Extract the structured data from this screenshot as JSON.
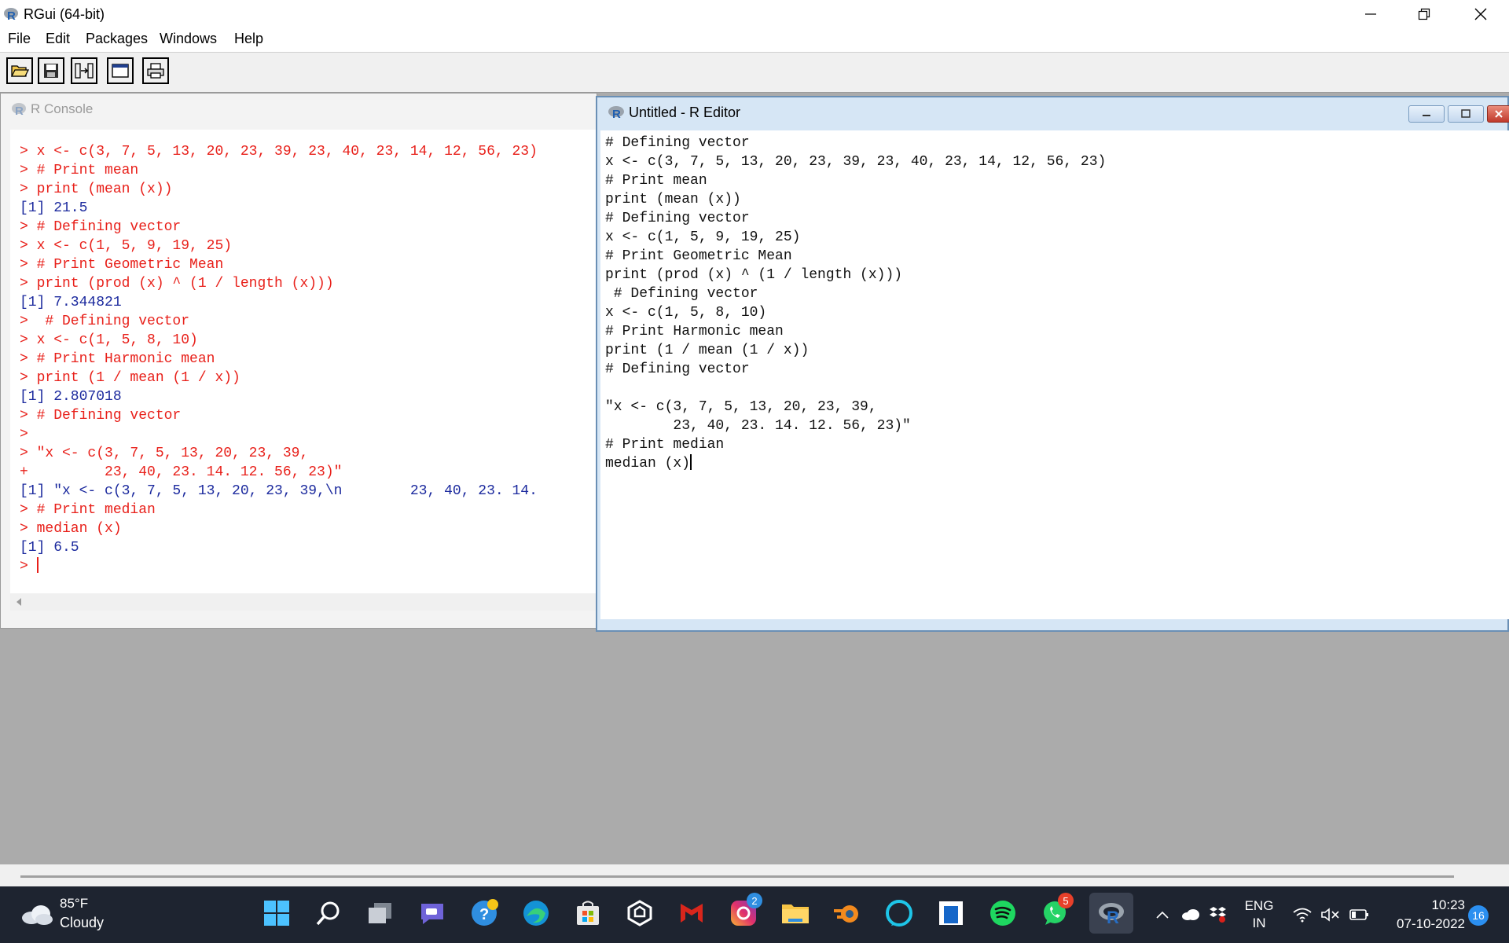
{
  "window": {
    "title": "RGui (64-bit)"
  },
  "menu": [
    "File",
    "Edit",
    "Packages",
    "Windows",
    "Help"
  ],
  "toolbar": {
    "buttons": [
      "open-script",
      "save",
      "load-workspace",
      "new-window",
      "print"
    ]
  },
  "console": {
    "title": "R Console",
    "lines": [
      {
        "t": "> x <- c(3, 7, 5, 13, 20, 23, 39, 23, 40, 23, 14, 12, 56, 23)",
        "k": "in"
      },
      {
        "t": "> # Print mean",
        "k": "in"
      },
      {
        "t": "> print (mean (x))",
        "k": "in"
      },
      {
        "t": "[1] 21.5",
        "k": "out"
      },
      {
        "t": "> # Defining vector",
        "k": "in"
      },
      {
        "t": "> x <- c(1, 5, 9, 19, 25)",
        "k": "in"
      },
      {
        "t": "> # Print Geometric Mean",
        "k": "in"
      },
      {
        "t": "> print (prod (x) ^ (1 / length (x)))",
        "k": "in"
      },
      {
        "t": "[1] 7.344821",
        "k": "out"
      },
      {
        "t": ">  # Defining vector",
        "k": "in"
      },
      {
        "t": "> x <- c(1, 5, 8, 10)",
        "k": "in"
      },
      {
        "t": "> # Print Harmonic mean",
        "k": "in"
      },
      {
        "t": "> print (1 / mean (1 / x))",
        "k": "in"
      },
      {
        "t": "[1] 2.807018",
        "k": "out"
      },
      {
        "t": "> # Defining vector",
        "k": "in"
      },
      {
        "t": ">",
        "k": "in"
      },
      {
        "t": "> \"x <- c(3, 7, 5, 13, 20, 23, 39,",
        "k": "in"
      },
      {
        "t": "+         23, 40, 23. 14. 12. 56, 23)\"",
        "k": "in"
      },
      {
        "t": "[1] \"x <- c(3, 7, 5, 13, 20, 23, 39,\\n        23, 40, 23. 14.",
        "k": "out"
      },
      {
        "t": "> # Print median",
        "k": "in"
      },
      {
        "t": "> median (x)",
        "k": "in"
      },
      {
        "t": "[1] 6.5",
        "k": "out"
      },
      {
        "t": "> ",
        "k": "in"
      }
    ]
  },
  "editor": {
    "title": "Untitled - R Editor",
    "lines": [
      "# Defining vector",
      "x <- c(3, 7, 5, 13, 20, 23, 39, 23, 40, 23, 14, 12, 56, 23)",
      "# Print mean",
      "print (mean (x))",
      "# Defining vector",
      "x <- c(1, 5, 9, 19, 25)",
      "# Print Geometric Mean",
      "print (prod (x) ^ (1 / length (x)))",
      " # Defining vector",
      "x <- c(1, 5, 8, 10)",
      "# Print Harmonic mean",
      "print (1 / mean (1 / x))",
      "# Defining vector",
      "",
      "\"x <- c(3, 7, 5, 13, 20, 23, 39,",
      "        23, 40, 23. 14. 12. 56, 23)\"",
      "# Print median",
      "median (x)"
    ]
  },
  "taskbar": {
    "weather": {
      "temp": "85°F",
      "condition": "Cloudy"
    },
    "apps": [
      {
        "name": "start-icon",
        "badge": ""
      },
      {
        "name": "search-icon",
        "badge": ""
      },
      {
        "name": "task-view-icon",
        "badge": ""
      },
      {
        "name": "teams-chat-icon",
        "badge": ""
      },
      {
        "name": "help-icon",
        "badge": ""
      },
      {
        "name": "edge-icon",
        "badge": ""
      },
      {
        "name": "store-icon",
        "badge": ""
      },
      {
        "name": "app-icon",
        "badge": ""
      },
      {
        "name": "mcafee-icon",
        "badge": ""
      },
      {
        "name": "instagram-icon",
        "badge": "2"
      },
      {
        "name": "file-explorer-icon",
        "badge": ""
      },
      {
        "name": "blender-icon",
        "badge": ""
      },
      {
        "name": "alexa-icon",
        "badge": ""
      },
      {
        "name": "notes-icon",
        "badge": ""
      },
      {
        "name": "spotify-icon",
        "badge": ""
      },
      {
        "name": "whatsapp-icon",
        "badge": "5"
      },
      {
        "name": "rgui-icon",
        "badge": ""
      }
    ],
    "lang": {
      "line1": "ENG",
      "line2": "IN"
    },
    "clock": {
      "time": "10:23",
      "date": "07-10-2022"
    },
    "notifications": "16"
  }
}
